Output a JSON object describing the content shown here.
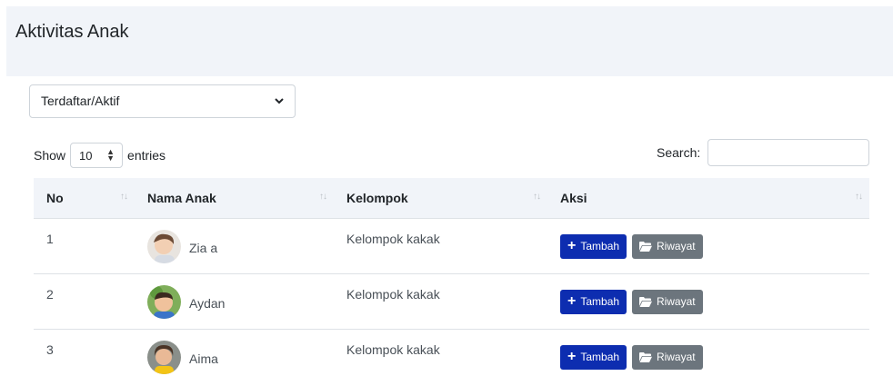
{
  "header": {
    "title": "Aktivitas Anak"
  },
  "filter": {
    "selected": "Terdaftar/Aktif"
  },
  "table_controls": {
    "show_label": "Show",
    "entries_value": "10",
    "entries_label": "entries",
    "search_label": "Search:"
  },
  "table": {
    "columns": [
      "No",
      "Nama Anak",
      "Kelompok",
      "Aksi"
    ],
    "rows": [
      {
        "no": "1",
        "name": "Zia a",
        "group": "Kelompok kakak"
      },
      {
        "no": "2",
        "name": "Aydan",
        "group": "Kelompok kakak"
      },
      {
        "no": "3",
        "name": "Aima",
        "group": "Kelompok kakak"
      }
    ]
  },
  "actions": {
    "add_label": "Tambah",
    "history_label": "Riwayat"
  },
  "colors": {
    "primary": "#0d2db0",
    "secondary": "#6c757d",
    "header_bg": "#f1f4f9"
  }
}
